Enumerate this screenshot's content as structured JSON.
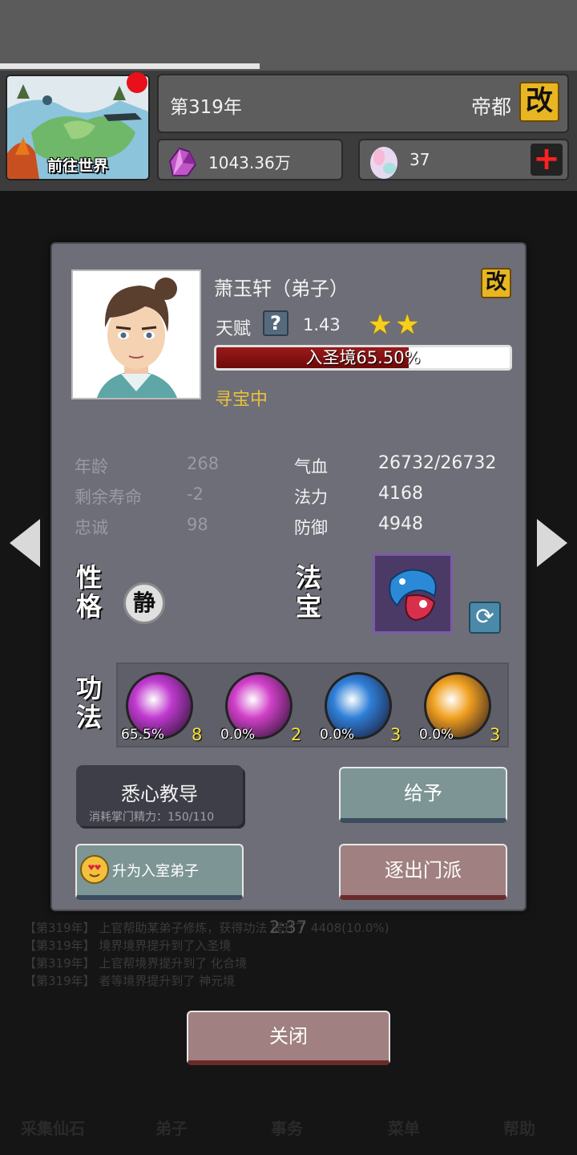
{
  "header": {
    "map_label": "前往世界",
    "year": "第319年",
    "capital": "帝都",
    "edit_glyph": "改",
    "spirit_stones": "1043.36万",
    "gems": "37",
    "plus_glyph": "+"
  },
  "background": {
    "timer": "2:37",
    "log_lines": [
      "【第319年】 上官帮助某弟子修炼，获得功法 提升了 4408(10.0%)",
      "【第319年】 境界境界提升到了入圣境",
      "【第319年】 上官帮境界提升到了 化合境",
      "【第319年】 者等境界提升到了 神元境"
    ],
    "nav": [
      "采集仙石",
      "弟子",
      "事务",
      "菜单",
      "帮助"
    ]
  },
  "disciple": {
    "name": "萧玉轩（弟子）",
    "edit_glyph": "改",
    "talent_label": "天赋",
    "talent_help": "?",
    "talent_value": "1.43",
    "stars": 2,
    "star_glyph": "★",
    "realm_progress_text": "入圣境65.50%",
    "realm_progress": 0.655,
    "status": "寻宝中",
    "stats_left": [
      {
        "label": "年龄",
        "value": "268"
      },
      {
        "label": "剩余寿命",
        "value": "-2"
      },
      {
        "label": "忠诚",
        "value": "98"
      }
    ],
    "stats_right": [
      {
        "label": "气血",
        "value": "26732/26732"
      },
      {
        "label": "法力",
        "value": "4168"
      },
      {
        "label": "防御",
        "value": "4948"
      }
    ],
    "personality_title": [
      "性",
      "格"
    ],
    "personality_badge": "静",
    "treasure_title": [
      "法",
      "宝"
    ],
    "swap_glyph": "⟳",
    "skills_title": [
      "功",
      "法"
    ],
    "skills": [
      {
        "pct": "65.5%",
        "level": "8",
        "color": "#c03ad0"
      },
      {
        "pct": "0.0%",
        "level": "2",
        "color": "#d040c8"
      },
      {
        "pct": "0.0%",
        "level": "3",
        "color": "#2f7fd8"
      },
      {
        "pct": "0.0%",
        "level": "3",
        "color": "#f0a020"
      }
    ]
  },
  "actions": {
    "teach_label": "悉心教导",
    "teach_cost": "消耗掌门精力：150/110",
    "give_label": "给予",
    "promote_label": "升为入室弟子",
    "expel_label": "逐出门派",
    "close_label": "关闭"
  }
}
